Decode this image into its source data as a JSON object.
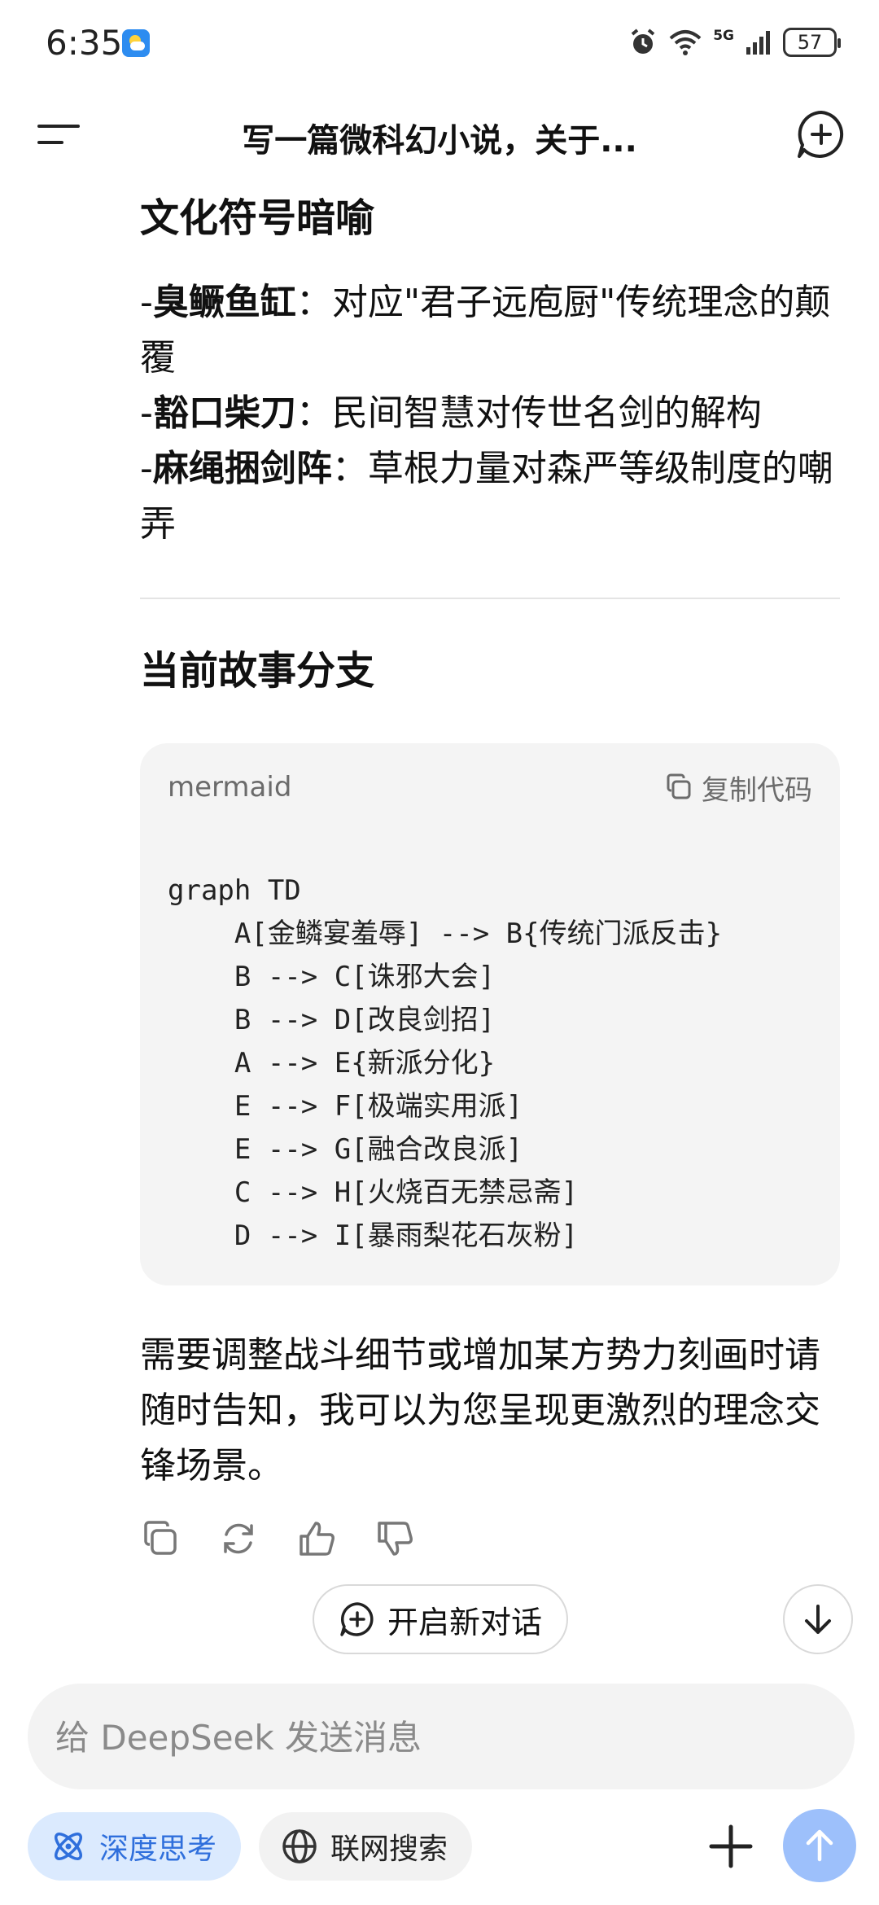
{
  "status_bar": {
    "time": "6:35",
    "network": "5G",
    "battery": "57"
  },
  "header": {
    "title": "写一篇微科幻小说，关于..."
  },
  "content": {
    "section1_title": "文化符号暗喻",
    "symbols": [
      {
        "prefix": "-",
        "term": "臭鳜鱼缸",
        "sep": "：",
        "desc": "对应\"君子远庖厨\"传统理念的颠覆"
      },
      {
        "prefix": "-",
        "term": "豁口柴刀",
        "sep": "：",
        "desc": "民间智慧对传世名剑的解构"
      },
      {
        "prefix": "-",
        "term": "麻绳捆剑阵",
        "sep": "：",
        "desc": "草根力量对森严等级制度的嘲弄"
      }
    ],
    "section2_title": "当前故事分支",
    "code": {
      "language": "mermaid",
      "copy_label": "复制代码",
      "lines": [
        "graph TD",
        "    A[金鳞宴羞辱] --> B{传统门派反击}",
        "    B --> C[诛邪大会]",
        "    B --> D[改良剑招]",
        "    A --> E{新派分化}",
        "    E --> F[极端实用派]",
        "    E --> G[融合改良派]",
        "    C --> H[火烧百无禁忌斋]",
        "    D --> I[暴雨梨花石灰粉]"
      ]
    },
    "closing": "需要调整战斗细节或增加某方势力刻画时请随时告知，我可以为您呈现更激烈的理念交锋场景。"
  },
  "floating": {
    "new_dialog_label": "开启新对话"
  },
  "composer": {
    "placeholder": "给 DeepSeek 发送消息",
    "deep_think_label": "深度思考",
    "web_search_label": "联网搜索"
  },
  "colors": {
    "accent": "#2f6fdc",
    "send_button": "#9dc0fb",
    "code_bg": "#f4f4f4"
  }
}
